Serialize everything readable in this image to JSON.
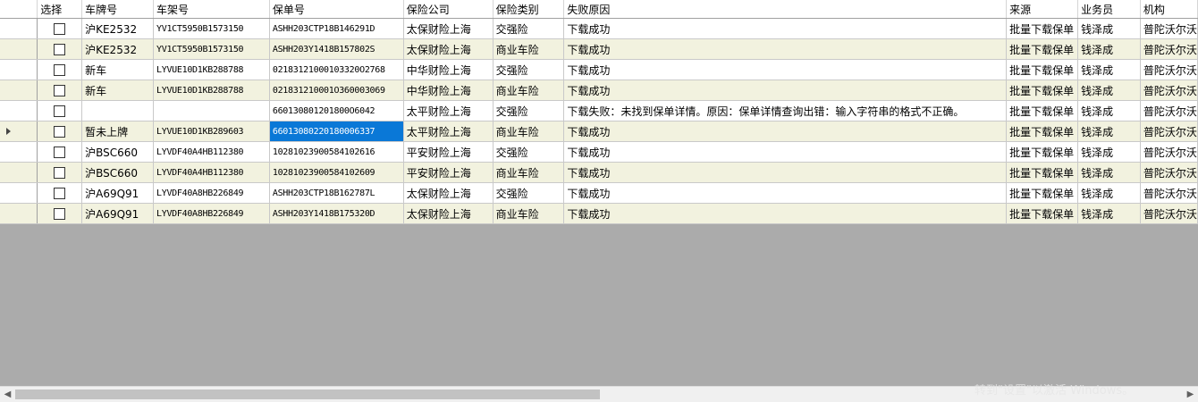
{
  "columns": [
    "",
    "选择",
    "车牌号",
    "车架号",
    "保单号",
    "保险公司",
    "保险类别",
    "失败原因",
    "来源",
    "业务员",
    "机构"
  ],
  "rows": [
    {
      "plate": "沪KE2532",
      "vin": "YV1CT5950B1573150",
      "policy": "ASHH203CTP18B146291D",
      "company": "太保财险上海",
      "category": "交强险",
      "reason": "下载成功",
      "source": "批量下载保单",
      "agent": "钱泽成",
      "org": "普陀沃尔沃"
    },
    {
      "plate": "沪KE2532",
      "vin": "YV1CT5950B1573150",
      "policy": "ASHH203Y1418B157802S",
      "company": "太保财险上海",
      "category": "商业车险",
      "reason": "下载成功",
      "source": "批量下载保单",
      "agent": "钱泽成",
      "org": "普陀沃尔沃"
    },
    {
      "plate": "新车",
      "vin": "LYVUE10D1KB288788",
      "policy": "02183121000103320O2768",
      "company": "中华财险上海",
      "category": "交强险",
      "reason": "下载成功",
      "source": "批量下载保单",
      "agent": "钱泽成",
      "org": "普陀沃尔沃"
    },
    {
      "plate": "新车",
      "vin": "LYVUE10D1KB288788",
      "policy": "021831210001O360003069",
      "company": "中华财险上海",
      "category": "商业车险",
      "reason": "下载成功",
      "source": "批量下载保单",
      "agent": "钱泽成",
      "org": "普陀沃尔沃"
    },
    {
      "plate": "",
      "vin": "",
      "policy": "660130801201800O6042",
      "company": "太平财险上海",
      "category": "交强险",
      "reason": "下载失败：未找到保单详情。原因：保单详情查询出错：输入字符串的格式不正确。",
      "source": "批量下载保单",
      "agent": "钱泽成",
      "org": "普陀沃尔沃"
    },
    {
      "plate": "暂未上牌",
      "vin": "LYVUE10D1KB289603",
      "policy": "66013080220180006337",
      "company": "太平财险上海",
      "category": "商业车险",
      "reason": "下载成功",
      "source": "批量下载保单",
      "agent": "钱泽成",
      "org": "普陀沃尔沃"
    },
    {
      "plate": "沪BSC660",
      "vin": "LYVDF40A4HB112380",
      "policy": "10281023900584102616",
      "company": "平安财险上海",
      "category": "交强险",
      "reason": "下载成功",
      "source": "批量下载保单",
      "agent": "钱泽成",
      "org": "普陀沃尔沃"
    },
    {
      "plate": "沪BSC660",
      "vin": "LYVDF40A4HB112380",
      "policy": "10281023900584102609",
      "company": "平安财险上海",
      "category": "商业车险",
      "reason": "下载成功",
      "source": "批量下载保单",
      "agent": "钱泽成",
      "org": "普陀沃尔沃"
    },
    {
      "plate": "沪A69Q91",
      "vin": "LYVDF40A8HB226849",
      "policy": "ASHH203CTP18B162787L",
      "company": "太保财险上海",
      "category": "交强险",
      "reason": "下载成功",
      "source": "批量下载保单",
      "agent": "钱泽成",
      "org": "普陀沃尔沃"
    },
    {
      "plate": "沪A69Q91",
      "vin": "LYVDF40A8HB226849",
      "policy": "ASHH203Y1418B175320D",
      "company": "太保财险上海",
      "category": "商业车险",
      "reason": "下载成功",
      "source": "批量下载保单",
      "agent": "钱泽成",
      "org": "普陀沃尔沃"
    }
  ],
  "current_row_index": 5,
  "watermark": "转到\"设置\"以激活 Windows。"
}
